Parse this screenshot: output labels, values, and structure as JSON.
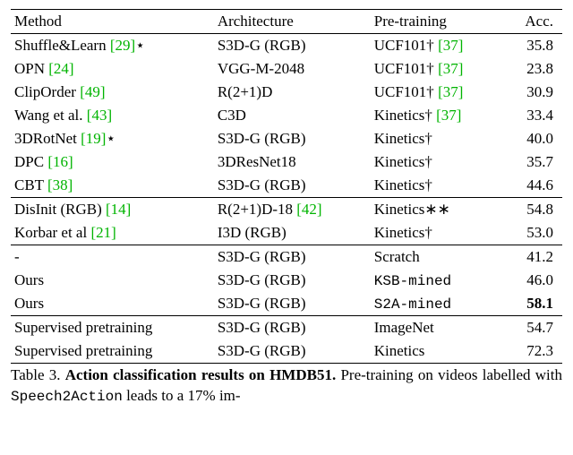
{
  "chart_data": {
    "type": "table",
    "title": "Action classification results on HMDB51",
    "columns": [
      "Method",
      "Architecture",
      "Pre-training",
      "Acc."
    ],
    "groups": [
      {
        "rows": [
          {
            "method": {
              "text": "Shuffle&Learn ",
              "cite": "[29]",
              "suffix": "⋆"
            },
            "arch": "S3D-G (RGB)",
            "pretrain": {
              "text": "UCF101† ",
              "cite": "[37]"
            },
            "acc": "35.8"
          },
          {
            "method": {
              "text": "OPN ",
              "cite": "[24]"
            },
            "arch": "VGG-M-2048",
            "pretrain": {
              "text": "UCF101† ",
              "cite": "[37]"
            },
            "acc": "23.8"
          },
          {
            "method": {
              "text": "ClipOrder ",
              "cite": "[49]"
            },
            "arch": "R(2+1)D",
            "pretrain": {
              "text": "UCF101† ",
              "cite": "[37]"
            },
            "acc": "30.9"
          },
          {
            "method": {
              "text": "Wang et al. ",
              "cite": "[43]"
            },
            "arch": "C3D",
            "pretrain": {
              "text": "Kinetics† ",
              "cite": "[37]"
            },
            "acc": "33.4"
          },
          {
            "method": {
              "text": "3DRotNet ",
              "cite": "[19]",
              "suffix": "⋆"
            },
            "arch": "S3D-G (RGB)",
            "pretrain": {
              "text": "Kinetics†"
            },
            "acc": "40.0"
          },
          {
            "method": {
              "text": "DPC ",
              "cite": "[16]"
            },
            "arch": "3DResNet18",
            "pretrain": {
              "text": "Kinetics†"
            },
            "acc": "35.7"
          },
          {
            "method": {
              "text": "CBT ",
              "cite": "[38]"
            },
            "arch": "S3D-G (RGB)",
            "pretrain": {
              "text": "Kinetics†"
            },
            "acc": "44.6"
          }
        ]
      },
      {
        "rows": [
          {
            "method": {
              "text": "DisInit (RGB) ",
              "cite": "[14]"
            },
            "arch": {
              "text": "R(2+1)D-18 ",
              "cite": "[42]"
            },
            "pretrain": {
              "text": "Kinetics∗∗"
            },
            "acc": "54.8"
          },
          {
            "method": {
              "text": "Korbar et al ",
              "cite": "[21]"
            },
            "arch": "I3D (RGB)",
            "pretrain": {
              "text": "Kinetics†"
            },
            "acc": "53.0"
          }
        ]
      },
      {
        "rows": [
          {
            "method": {
              "text": "-"
            },
            "arch": "S3D-G (RGB)",
            "pretrain": {
              "text": "Scratch"
            },
            "acc": "41.2"
          },
          {
            "method": {
              "text": "Ours"
            },
            "arch": "S3D-G (RGB)",
            "pretrain": {
              "tt": "KSB-mined"
            },
            "acc": "46.0"
          },
          {
            "method": {
              "text": "Ours"
            },
            "arch": "S3D-G (RGB)",
            "pretrain": {
              "tt": "S2A-mined"
            },
            "acc": "58.1",
            "bold": true
          }
        ]
      },
      {
        "rows": [
          {
            "method": {
              "text": "Supervised pretraining"
            },
            "arch": "S3D-G (RGB)",
            "pretrain": {
              "text": "ImageNet"
            },
            "acc": "54.7"
          },
          {
            "method": {
              "text": "Supervised pretraining"
            },
            "arch": "S3D-G (RGB)",
            "pretrain": {
              "text": "Kinetics"
            },
            "acc": "72.3"
          }
        ]
      }
    ]
  },
  "headers": {
    "method": "Method",
    "arch": "Architecture",
    "pretrain": "Pre-training",
    "acc": "Acc."
  },
  "caption": {
    "label": "Table 3. ",
    "title": "Action classification results on HMDB51.",
    "rest_a": " Pre-training on videos labelled with ",
    "tt": "Speech2Action",
    "rest_b": " leads to a 17% im-"
  }
}
